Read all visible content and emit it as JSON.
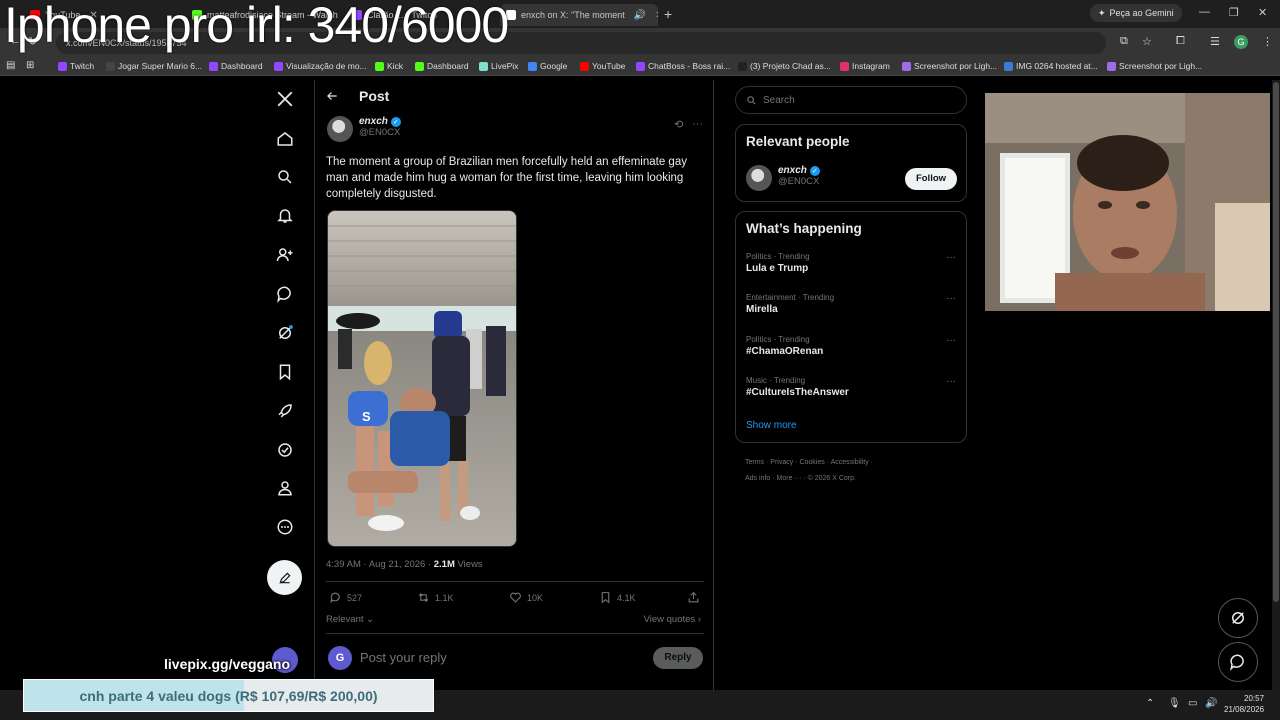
{
  "overlay": {
    "title": "Iphone pro irl: 340/6000",
    "livepix": "livepix.gg/veggano",
    "goal_text": "cnh parte 4 valeu dogs (R$ 107,69/R$ 200,00)",
    "goal_progress": 0.538
  },
  "browser": {
    "tabs": [
      {
        "label": "YouTube",
        "color": "#ff0000"
      },
      {
        "label": "matteafrodisiaco Stream - Watch",
        "color": "#53fc18"
      },
      {
        "label": "Clarão ... - Twitch",
        "color": "#9146ff"
      },
      {
        "label": "enxch on X: \"The moment",
        "color": "#ffffff"
      }
    ],
    "new_tab": "+",
    "gemini_label": "Peça ao Gemini",
    "url": "x.com/EN0CX/status/1958734",
    "bookmarks": [
      {
        "label": "Twitch",
        "color": "#9146ff"
      },
      {
        "label": "Jogar Super Mario 6...",
        "color": "#444"
      },
      {
        "label": "Dashboard",
        "color": "#9146ff"
      },
      {
        "label": "Visualização de mo...",
        "color": "#9146ff"
      },
      {
        "label": "Kick",
        "color": "#53fc18"
      },
      {
        "label": "Dashboard",
        "color": "#53fc18"
      },
      {
        "label": "LivePix",
        "color": "#7ee0c9"
      },
      {
        "label": "Google",
        "color": "#4285f4"
      },
      {
        "label": "YouTube",
        "color": "#ff0000"
      },
      {
        "label": "ChatBoss - Boss rai...",
        "color": "#9146ff"
      },
      {
        "label": "(3) Projeto Chad as...",
        "color": "#222"
      },
      {
        "label": "Instagram",
        "color": "#e1306c"
      },
      {
        "label": "Screenshot por Ligh...",
        "color": "#a16ae8"
      },
      {
        "label": "IMG 0264 hosted at...",
        "color": "#3a7bd5"
      },
      {
        "label": "Screenshot por Ligh...",
        "color": "#a16ae8"
      }
    ],
    "profile_initial": "G"
  },
  "post": {
    "header": "Post",
    "author_name": "enxch",
    "author_handle": "@EN0CX",
    "text": "The moment a group of Brazilian men forcefully held an effeminate gay man and made him hug a woman for the first time, leaving him looking completely disgusted.",
    "timestamp": "4:39 AM · Aug 21, 2026 · ",
    "views_count": "2.1M",
    "views_label": "Views",
    "replies": "527",
    "reposts": "1.1K",
    "likes": "10K",
    "bookmarks": "4.1K",
    "sort_label": "Relevant",
    "view_quotes": "View quotes",
    "reply_placeholder": "Post your reply",
    "reply_button": "Reply",
    "reply_avatar_initial": "G"
  },
  "sidebar": {
    "search_placeholder": "Search",
    "relevant_title": "Relevant people",
    "person_name": "enxch",
    "person_handle": "@EN0CX",
    "follow_label": "Follow",
    "happening_title": "What’s happening",
    "trends": [
      {
        "category": "Politics · Trending",
        "name": "Lula e Trump"
      },
      {
        "category": "Entertainment · Trending",
        "name": "Mirella"
      },
      {
        "category": "Politics · Trending",
        "name": "#ChamaORenan"
      },
      {
        "category": "Music · Trending",
        "name": "#CultureIsTheAnswer"
      }
    ],
    "show_more": "Show more",
    "footer_line1": "Terms  ·  Privacy  ·  Cookies  ·  Accessibility  ·",
    "footer_line2": "Ads info  ·  More ···  ·  © 2026 X Corp."
  },
  "taskbar": {
    "time": "20:57",
    "date": "21/08/2026"
  }
}
